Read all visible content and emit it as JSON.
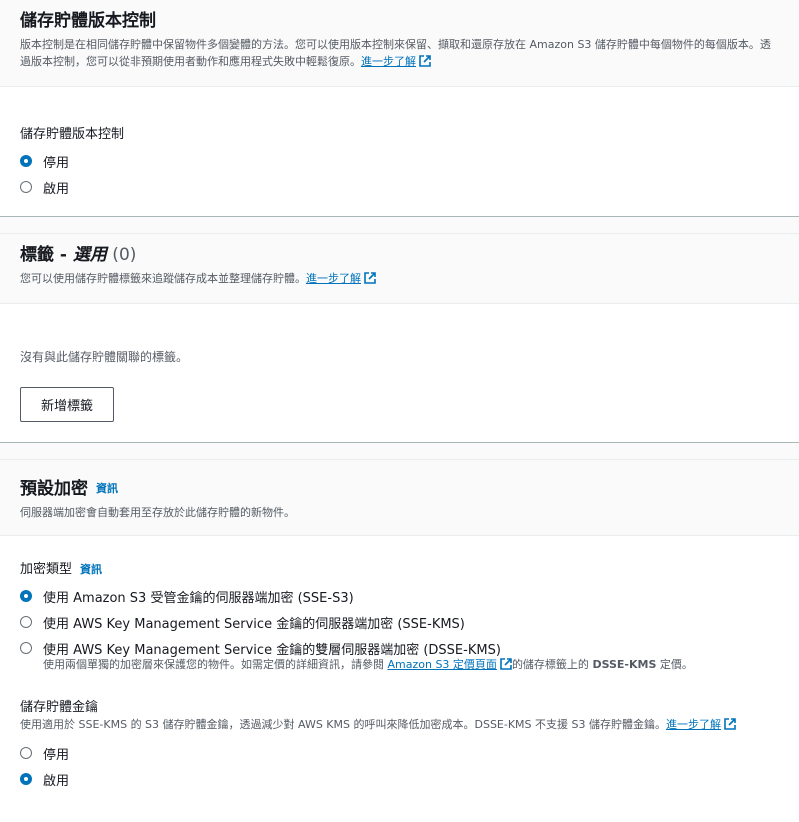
{
  "versioning": {
    "title": "儲存貯體版本控制",
    "desc": "版本控制是在相同儲存貯體中保留物件多個變體的方法。您可以使用版本控制來保留、擷取和還原存放在 Amazon S3 儲存貯體中每個物件的每個版本。透過版本控制，您可以從非預期使用者動作和應用程式失敗中輕鬆復原。",
    "learn_more": "進一步了解",
    "field_label": "儲存貯體版本控制",
    "options": [
      "停用",
      "啟用"
    ],
    "selected": "停用"
  },
  "tags": {
    "title": "標籤 - ",
    "optional": "選用",
    "count": " (0)",
    "desc": "您可以使用儲存貯體標籤來追蹤儲存成本並整理儲存貯體。",
    "learn_more": "進一步了解",
    "empty_text": "沒有與此儲存貯體關聯的標籤。",
    "add_button": "新增標籤"
  },
  "encryption": {
    "title": "預設加密",
    "info": "資訊",
    "desc": "伺服器端加密會自動套用至存放於此儲存貯體的新物件。",
    "type_label": "加密類型",
    "type_info": "資訊",
    "options": [
      "使用 Amazon S3 受管金鑰的伺服器端加密 (SSE-S3)",
      "使用 AWS Key Management Service 金鑰的伺服器端加密 (SSE-KMS)",
      "使用 AWS Key Management Service 金鑰的雙層伺服器端加密 (DSSE-KMS)"
    ],
    "selected": "使用 Amazon S3 受管金鑰的伺服器端加密 (SSE-S3)",
    "dsse_desc_pre": "使用兩個單獨的加密層來保護您的物件。如需定價的詳細資訊，請參閱 ",
    "dsse_link": "Amazon S3 定價頁面",
    "dsse_desc_post": "的儲存標籤上的 ",
    "dsse_bold": "DSSE-KMS",
    "dsse_end": " 定價。",
    "bucket_key_label": "儲存貯體金鑰",
    "bucket_key_desc": "使用適用於 SSE-KMS 的 S3 儲存貯體金鑰，透過減少對 AWS KMS 的呼叫來降低加密成本。DSSE-KMS 不支援 S3 儲存貯體金鑰。",
    "bucket_key_learn_more": "進一步了解",
    "bucket_key_options": [
      "停用",
      "啟用"
    ],
    "bucket_key_selected": "啟用"
  },
  "colors": {
    "accent": "#0073bb",
    "text": "#16191f",
    "muted": "#545b64"
  }
}
